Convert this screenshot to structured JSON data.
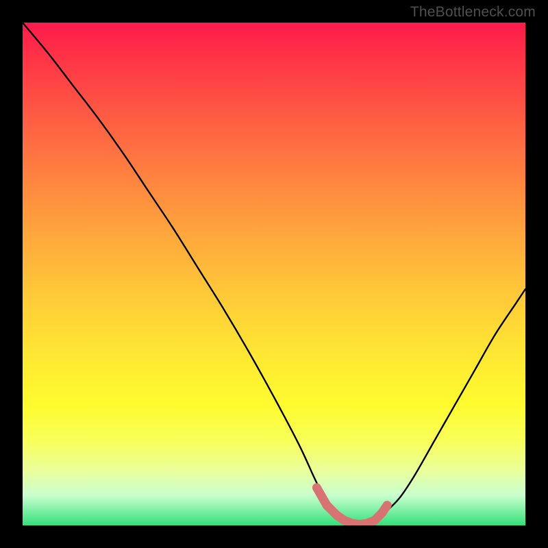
{
  "watermark": "TheBottleneck.com",
  "chart_data": {
    "type": "line",
    "title": "",
    "xlabel": "",
    "ylabel": "",
    "xlim": [
      0,
      100
    ],
    "ylim": [
      0,
      100
    ],
    "x": [
      0,
      5,
      10,
      15,
      20,
      25,
      30,
      35,
      40,
      45,
      50,
      55,
      58,
      60,
      62,
      64,
      66,
      68,
      70,
      72,
      75,
      78,
      82,
      86,
      90,
      94,
      98,
      100
    ],
    "values": [
      100,
      94,
      87.5,
      81,
      74,
      66.5,
      59,
      51,
      43,
      34.5,
      25.5,
      16,
      9.5,
      5.5,
      2.5,
      1,
      0.3,
      0.3,
      1,
      2.5,
      5.5,
      10,
      17,
      24,
      31,
      38,
      44,
      47
    ],
    "highlight": {
      "type": "scatter",
      "color": "#d87373",
      "x": [
        58.5,
        60.5,
        62.5,
        64,
        65.5,
        67,
        68.5,
        70,
        71.5,
        72.5
      ],
      "values": [
        7.5,
        4,
        2,
        1,
        0.4,
        0.2,
        0.4,
        1,
        2.5,
        4
      ]
    },
    "gradient_stops": [
      {
        "pos": 0,
        "color": "#ff1a4b"
      },
      {
        "pos": 18,
        "color": "#ff5944"
      },
      {
        "pos": 42,
        "color": "#ffa63c"
      },
      {
        "pos": 66,
        "color": "#ffe733"
      },
      {
        "pos": 89,
        "color": "#eaff9a"
      },
      {
        "pos": 100,
        "color": "#33e07a"
      }
    ]
  }
}
